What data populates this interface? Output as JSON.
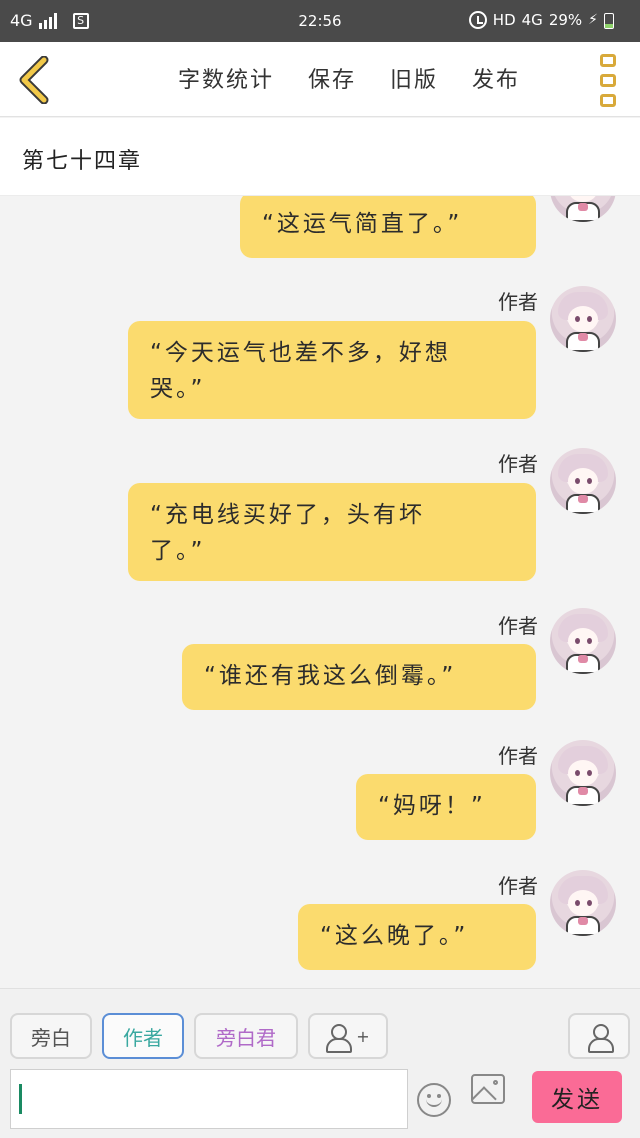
{
  "status_bar": {
    "network": "4G",
    "sim_label": "S",
    "time": "22:56",
    "hd": "HD",
    "network_right": "4G",
    "battery": "29%",
    "battery_level": 0.29
  },
  "toolbar": {
    "back_icon": "chevron-left-icon",
    "actions": [
      "字数统计",
      "保存",
      "旧版",
      "发布"
    ],
    "menu_icon": "more-vertical-icon"
  },
  "chapter": {
    "title": "第七十四章"
  },
  "messages": [
    {
      "sender": "",
      "text_lines": [
        "“这运气简直了。”"
      ]
    },
    {
      "sender": "作者",
      "text_lines": [
        "“今天运气也差不多，好想",
        "哭。”"
      ]
    },
    {
      "sender": "作者",
      "text_lines": [
        "“充电线买好了，头有坏",
        "了。”"
      ]
    },
    {
      "sender": "作者",
      "text_lines": [
        "“谁还有我这么倒霉。”"
      ]
    },
    {
      "sender": "作者",
      "text_lines": [
        "“妈呀！”"
      ]
    },
    {
      "sender": "作者",
      "text_lines": [
        "“这么晚了。”"
      ]
    }
  ],
  "bottom": {
    "roles": [
      "旁白",
      "作者",
      "旁白君"
    ],
    "add_role_plus": "+",
    "input_value": "",
    "emoji_icon": "emoji-icon",
    "image_icon": "image-icon",
    "send_label": "发送"
  },
  "colors": {
    "bubble": "#fbdb6e",
    "send_button": "#fa6b96",
    "active_chip_border": "#5b8ed6"
  }
}
